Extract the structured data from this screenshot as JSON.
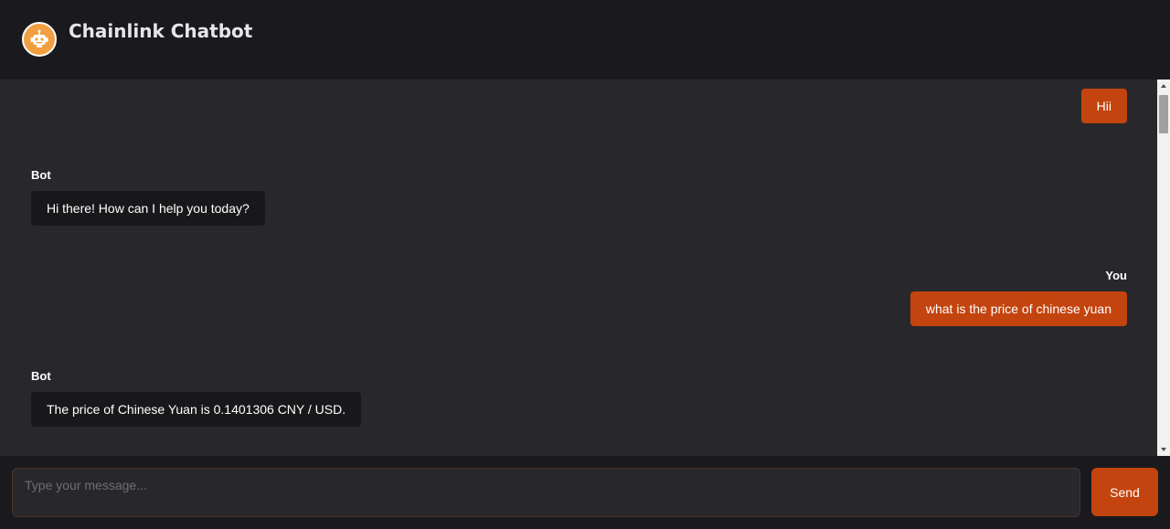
{
  "header": {
    "title": "Chainlink Chatbot",
    "logo_icon": "robot-icon"
  },
  "messages": [
    {
      "role": "user",
      "sender": "",
      "text": "Hii"
    },
    {
      "role": "bot",
      "sender": "Bot",
      "text": "Hi there! How can I help you today?"
    },
    {
      "role": "user",
      "sender": "You",
      "text": "what is the price of chinese yuan"
    },
    {
      "role": "bot",
      "sender": "Bot",
      "text": "The price of Chinese Yuan is 0.1401306 CNY / USD."
    }
  ],
  "composer": {
    "placeholder": "Type your message...",
    "value": "",
    "send_label": "Send"
  },
  "colors": {
    "accent": "#c3440e",
    "header_bg": "#1a1a1e",
    "chat_bg": "#28282c",
    "bot_bubble": "#18181b",
    "logo": "#f0a040"
  }
}
